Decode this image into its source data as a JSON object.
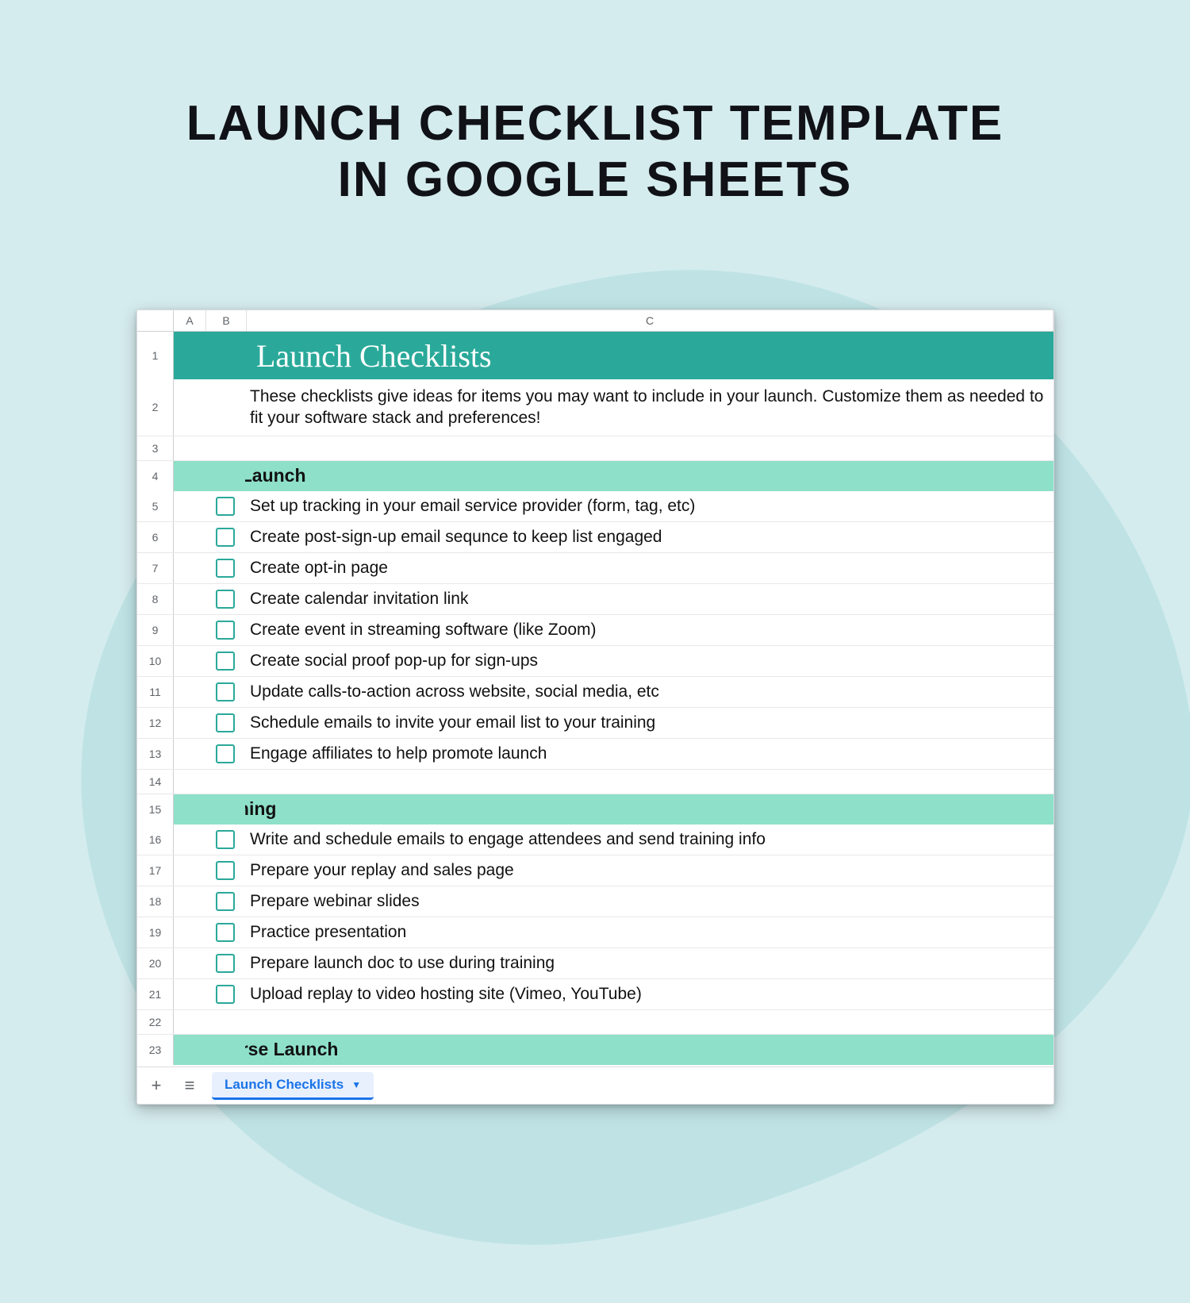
{
  "headline_line1": "LAUNCH CHECKLIST TEMPLATE",
  "headline_line2": "IN GOOGLE SHEETS",
  "columns": {
    "A": "A",
    "B": "B",
    "C": "C"
  },
  "sheet": {
    "title": "Launch Checklists",
    "description": "These checklists give ideas for items you may want to include in your launch. Customize them as needed to fit your software stack and preferences!",
    "rows": [
      {
        "n": "1",
        "type": "title"
      },
      {
        "n": "2",
        "type": "desc"
      },
      {
        "n": "3",
        "type": "blank"
      },
      {
        "n": "4",
        "type": "section",
        "text": "Pre-Launch"
      },
      {
        "n": "5",
        "type": "item",
        "text": "Set up tracking in your email service provider (form, tag, etc)"
      },
      {
        "n": "6",
        "type": "item",
        "text": "Create post-sign-up email sequnce to keep list engaged"
      },
      {
        "n": "7",
        "type": "item",
        "text": "Create opt-in page"
      },
      {
        "n": "8",
        "type": "item",
        "text": "Create calendar invitation link"
      },
      {
        "n": "9",
        "type": "item",
        "text": "Create event in streaming software (like Zoom)"
      },
      {
        "n": "10",
        "type": "item",
        "text": "Create social proof pop-up for sign-ups"
      },
      {
        "n": "11",
        "type": "item",
        "text": "Update calls-to-action across website, social media, etc"
      },
      {
        "n": "12",
        "type": "item",
        "text": "Schedule emails to invite your email list to your training"
      },
      {
        "n": "13",
        "type": "item",
        "text": "Engage affiliates to help promote launch"
      },
      {
        "n": "14",
        "type": "blank"
      },
      {
        "n": "15",
        "type": "section",
        "text": "Training"
      },
      {
        "n": "16",
        "type": "item",
        "text": "Write and schedule emails to engage attendees and send training info"
      },
      {
        "n": "17",
        "type": "item",
        "text": "Prepare your replay and sales page"
      },
      {
        "n": "18",
        "type": "item",
        "text": "Prepare webinar slides"
      },
      {
        "n": "19",
        "type": "item",
        "text": "Practice presentation"
      },
      {
        "n": "20",
        "type": "item",
        "text": "Prepare launch doc to use during training"
      },
      {
        "n": "21",
        "type": "item",
        "text": "Upload replay to video hosting site (Vimeo, YouTube)"
      },
      {
        "n": "22",
        "type": "blank"
      },
      {
        "n": "23",
        "type": "section",
        "text": "Course Launch"
      }
    ]
  },
  "tabbar": {
    "add": "+",
    "menu": "≡",
    "tab_label": "Launch Checklists"
  }
}
